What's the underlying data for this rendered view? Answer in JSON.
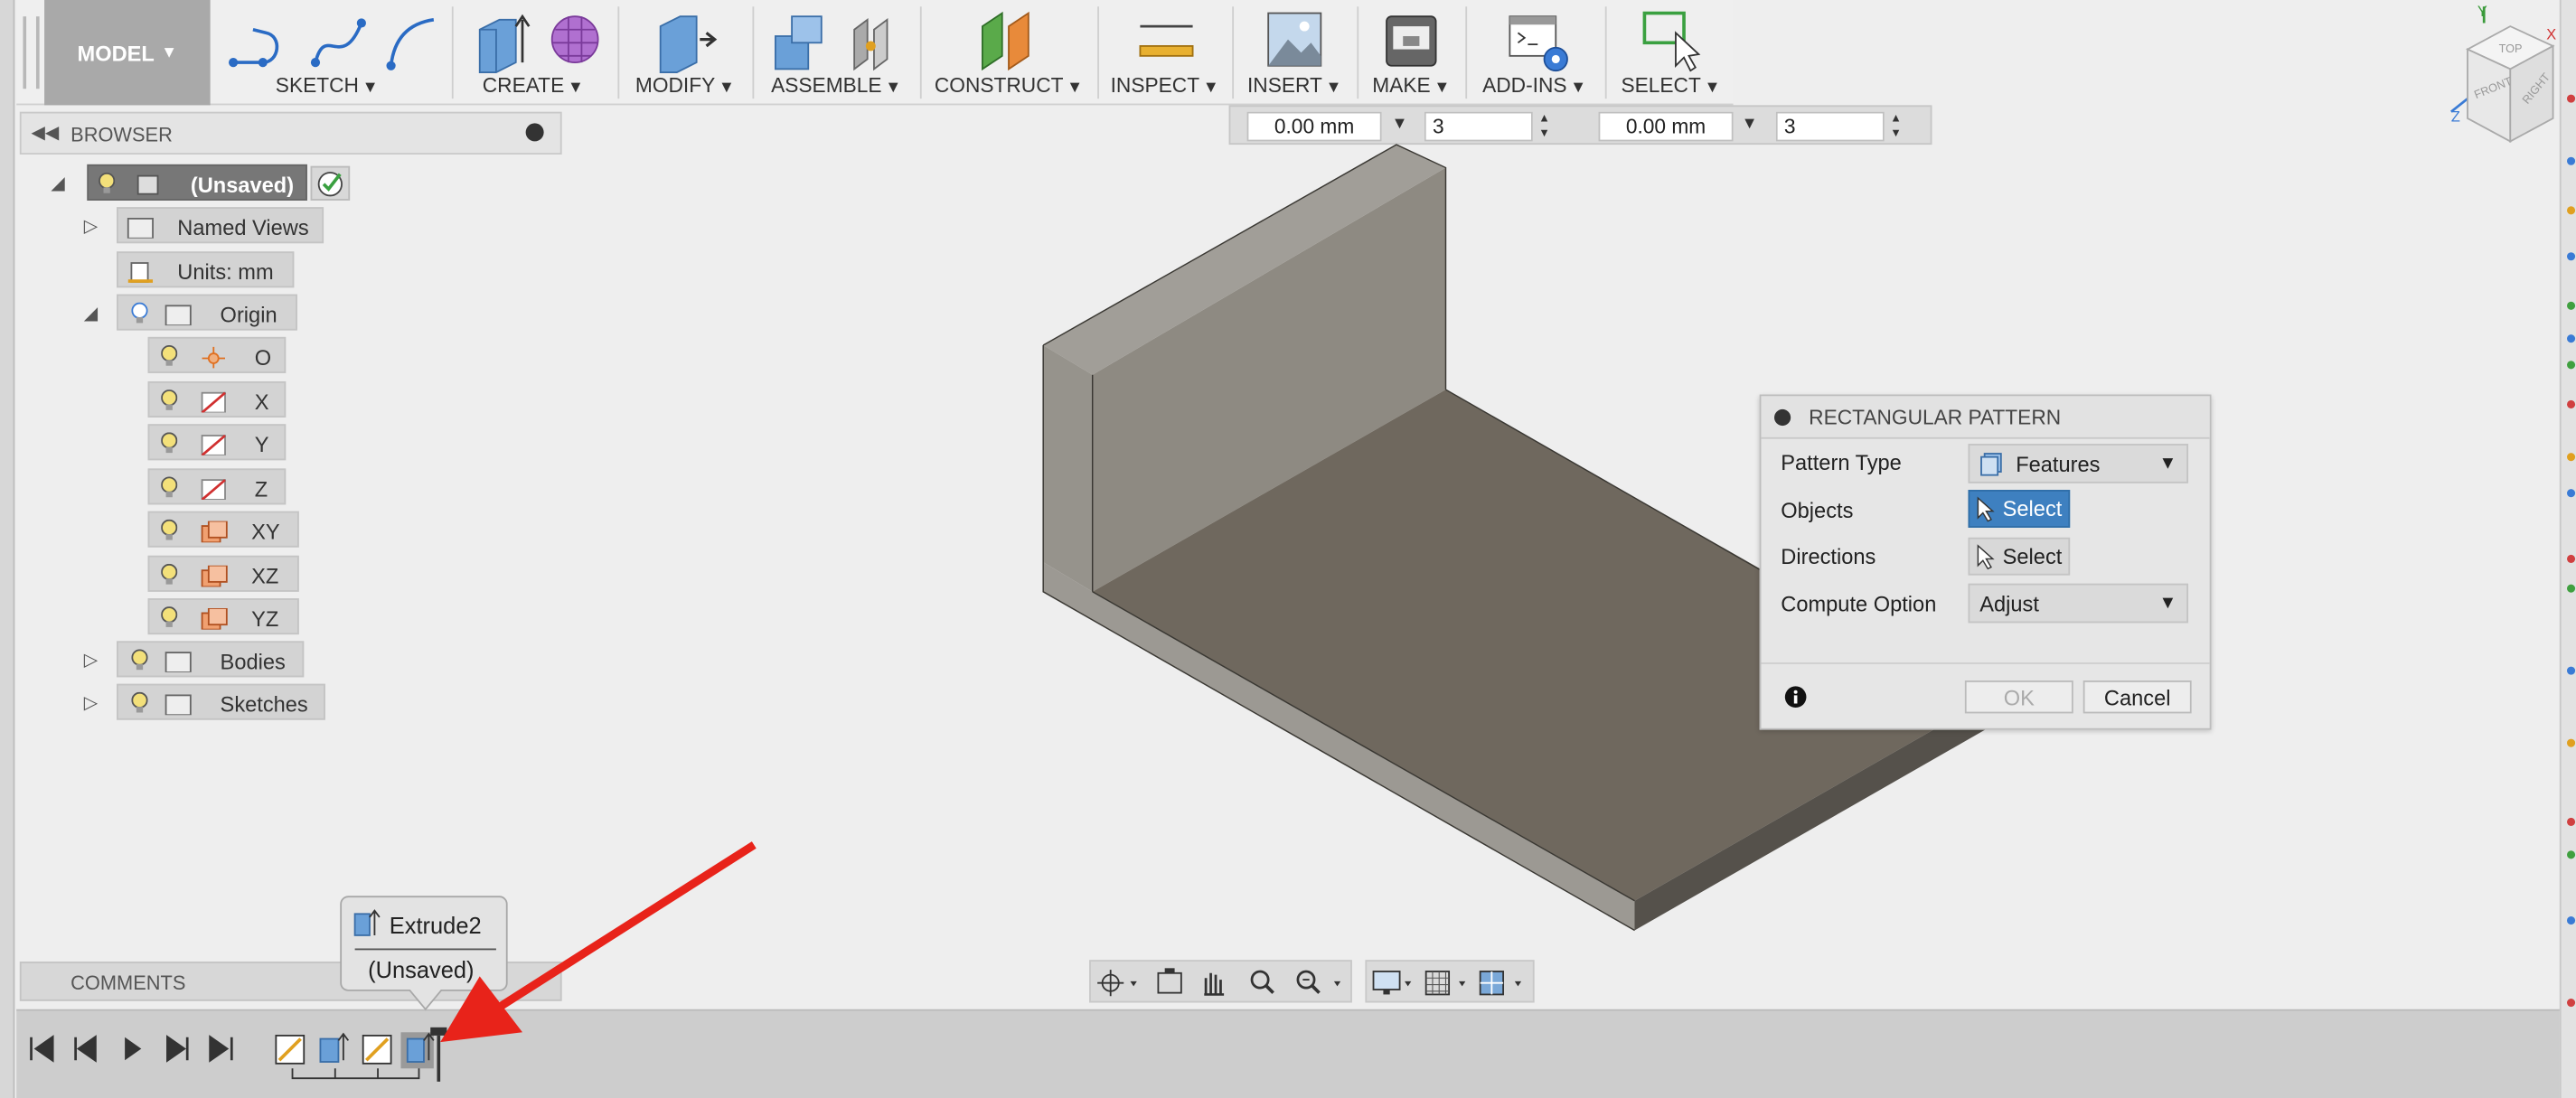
{
  "toolbar": {
    "workspace_label": "MODEL",
    "groups": [
      {
        "label": "SKETCH"
      },
      {
        "label": "CREATE"
      },
      {
        "label": "MODIFY"
      },
      {
        "label": "ASSEMBLE"
      },
      {
        "label": "CONSTRUCT"
      },
      {
        "label": "INSPECT"
      },
      {
        "label": "INSERT"
      },
      {
        "label": "MAKE"
      },
      {
        "label": "ADD-INS"
      },
      {
        "label": "SELECT"
      }
    ]
  },
  "browser": {
    "title": "BROWSER",
    "root": "(Unsaved)",
    "items": [
      {
        "label": "Named Views"
      },
      {
        "label": "Units: mm"
      },
      {
        "label": "Origin"
      },
      {
        "label": "O"
      },
      {
        "label": "X"
      },
      {
        "label": "Y"
      },
      {
        "label": "Z"
      },
      {
        "label": "XY"
      },
      {
        "label": "XZ"
      },
      {
        "label": "YZ"
      },
      {
        "label": "Bodies"
      },
      {
        "label": "Sketches"
      }
    ]
  },
  "dimension_bar": {
    "distance1": "0.00 mm",
    "quantity1": "3",
    "distance2": "0.00 mm",
    "quantity2": "3"
  },
  "dialog": {
    "title": "RECTANGULAR PATTERN",
    "pattern_type_label": "Pattern Type",
    "pattern_type_value": "Features",
    "objects_label": "Objects",
    "objects_button": "Select",
    "directions_label": "Directions",
    "directions_button": "Select",
    "compute_option_label": "Compute Option",
    "compute_option_value": "Adjust",
    "ok_label": "OK",
    "cancel_label": "Cancel"
  },
  "comments": {
    "title": "COMMENTS"
  },
  "tooltip": {
    "feature": "Extrude2",
    "document": "(Unsaved)"
  },
  "viewcube": {
    "top": "TOP",
    "front": "FRONT",
    "right": "RIGHT",
    "axis_x": "X",
    "axis_y": "Y",
    "axis_z": "Z"
  },
  "colors": {
    "selected_button": "#3e80c0",
    "workspace_bg": "#a9a9a9",
    "annotation_arrow": "#e8231a",
    "model_face": "#8a8479"
  }
}
